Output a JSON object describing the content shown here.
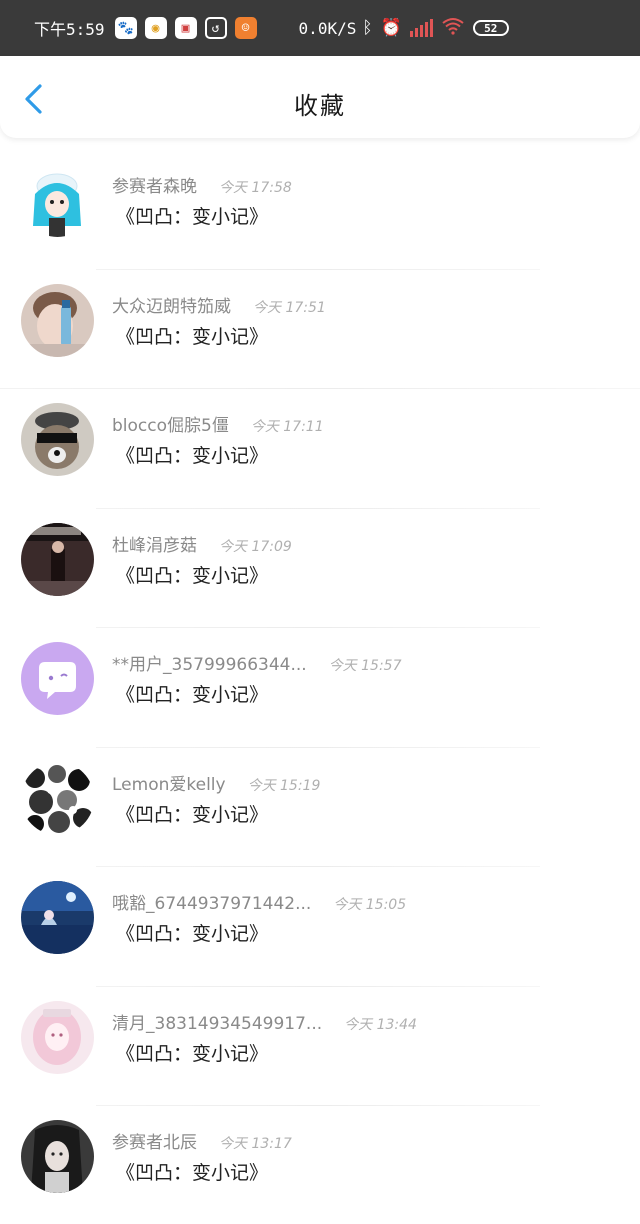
{
  "status_bar": {
    "time": "下午5:59",
    "net_speed": "0.0K/S",
    "battery": "52"
  },
  "header": {
    "title": "收藏"
  },
  "items": [
    {
      "user": "参赛者森晚",
      "time": "今天 17:58",
      "content": "《凹凸：变小记》"
    },
    {
      "user": "大众迈朗特笳威",
      "time": "今天 17:51",
      "content": "《凹凸：变小记》"
    },
    {
      "user": "blocco倔腙5僵",
      "time": "今天 17:11",
      "content": "《凹凸：变小记》"
    },
    {
      "user": "杜峰涓彦菇",
      "time": "今天 17:09",
      "content": "《凹凸：变小记》"
    },
    {
      "user": "**用户_35799966344...",
      "time": "今天 15:57",
      "content": "《凹凸：变小记》"
    },
    {
      "user": "Lemon爱kelly",
      "time": "今天 15:19",
      "content": "《凹凸：变小记》"
    },
    {
      "user": "哦豁_6744937971442...",
      "time": "今天 15:05",
      "content": "《凹凸：变小记》"
    },
    {
      "user": "清月_38314934549917...",
      "time": "今天 13:44",
      "content": "《凹凸：变小记》"
    },
    {
      "user": "参赛者北辰",
      "time": "今天 13:17",
      "content": "《凹凸：变小记》"
    }
  ],
  "colors": {
    "accent": "#2f9be8",
    "status_bar_bg": "#3a3a3a"
  }
}
